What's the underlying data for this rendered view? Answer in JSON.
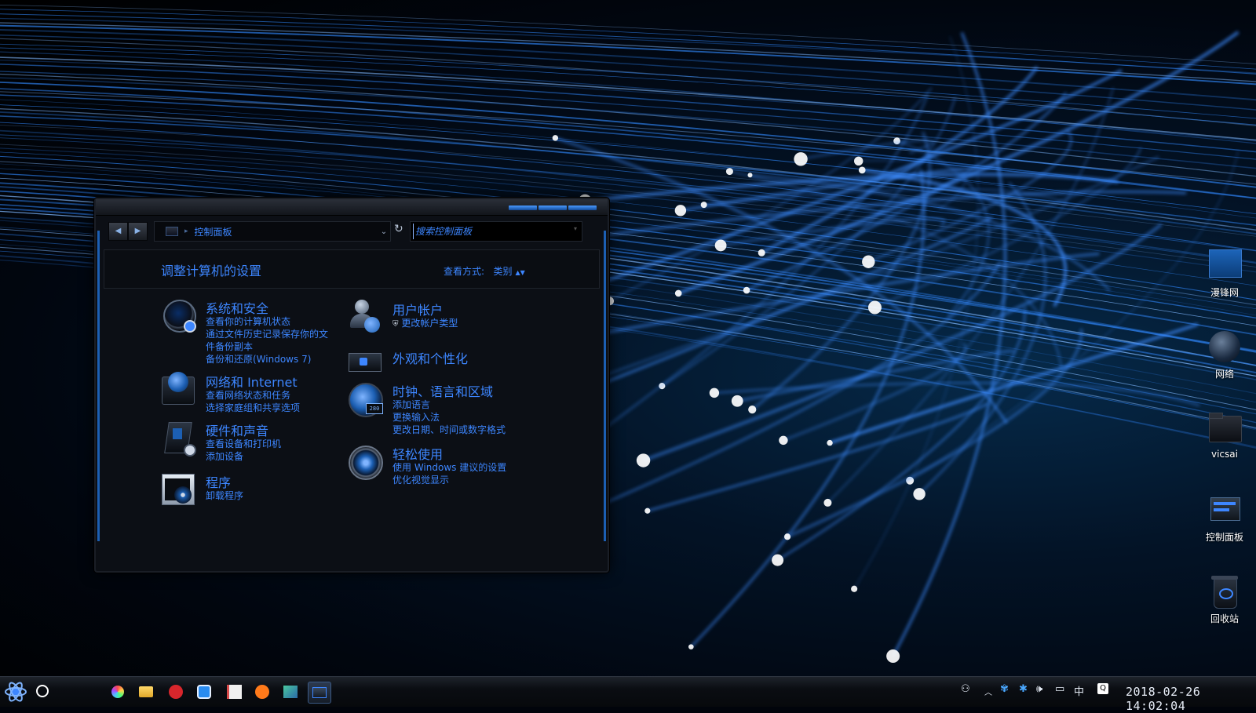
{
  "window": {
    "address": {
      "crumb": "控制面板"
    },
    "search": {
      "placeholder": "搜索控制面板"
    },
    "header": {
      "title": "调整计算机的设置",
      "view_label": "查看方式:",
      "view_value": "类别"
    },
    "categories_left": [
      {
        "title": "系统和安全",
        "icon": "shield-globe-icon",
        "links": [
          "查看你的计算机状态",
          "通过文件历史记录保存你的文",
          "件备份副本",
          "备份和还原(Windows 7)"
        ]
      },
      {
        "title": "网络和 Internet",
        "icon": "network-globe-icon",
        "links": [
          "查看网络状态和任务",
          "选择家庭组和共享选项"
        ]
      },
      {
        "title": "硬件和声音",
        "icon": "printer-speaker-icon",
        "links": [
          "查看设备和打印机",
          "添加设备"
        ]
      },
      {
        "title": "程序",
        "icon": "program-disc-icon",
        "links": [
          "卸载程序"
        ]
      }
    ],
    "categories_right": [
      {
        "title": "用户帐户",
        "icon": "users-icon",
        "links": [
          "更改帐户类型"
        ]
      },
      {
        "title": "外观和个性化",
        "icon": "monitor-personalize-icon",
        "links": []
      },
      {
        "title": "时钟、语言和区域",
        "icon": "clock-globe-icon",
        "links": [
          "添加语言",
          "更换输入法",
          "更改日期、时间或数字格式"
        ]
      },
      {
        "title": "轻松使用",
        "icon": "ease-of-access-icon",
        "links": [
          "使用 Windows 建议的设置",
          "优化视觉显示"
        ]
      }
    ]
  },
  "desktop_icons": [
    {
      "label": "漫锋网",
      "icon": "blue-square-icon"
    },
    {
      "label": "网络",
      "icon": "network-globe-icon"
    },
    {
      "label": "vicsai",
      "icon": "folder-icon"
    },
    {
      "label": "控制面板",
      "icon": "control-panel-icon"
    },
    {
      "label": "回收站",
      "icon": "recycle-bin-icon"
    }
  ],
  "taskbar": {
    "apps": [
      "color-wheel-icon",
      "file-explorer-icon",
      "red-badge-icon",
      "teamviewer-icon",
      "notepad-icon",
      "orange-badge-icon",
      "image-editor-icon",
      "control-panel-icon"
    ],
    "tray": {
      "ime": "中"
    },
    "clock": "2018-02-26  14:02:04"
  },
  "colors": {
    "link_blue": "#3d86ff",
    "accent": "#1c5fb3"
  }
}
